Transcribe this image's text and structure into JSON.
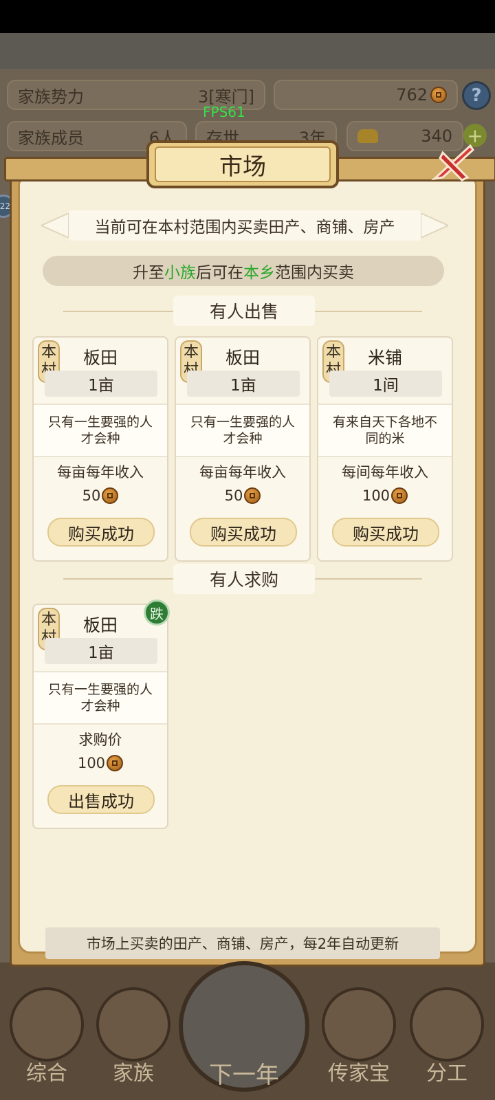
{
  "header": {
    "clan_power_label": "家族势力",
    "clan_power_value": "3[寒门]",
    "coins": "762",
    "members_label": "家族成员",
    "members_value": "6人",
    "alive_label": "存世",
    "alive_value": "3年",
    "gold": "340",
    "help": "?",
    "plus": "+",
    "side_badge": "22"
  },
  "fps": "FPS61",
  "market": {
    "title": "市场",
    "scope_note": "当前可在本村范围内买卖田产、商铺、房产",
    "upgrade_note": {
      "prefix": "升至",
      "rank": "小族",
      "middle": "后可在",
      "area": "本乡",
      "suffix": "范围内买卖"
    },
    "selling_section": "有人出售",
    "selling": [
      {
        "tag": [
          "本",
          "村"
        ],
        "name": "板田",
        "qty": "1亩",
        "desc": "只有一生要强的人才会种",
        "income_label": "每亩每年收入",
        "price": "50",
        "button": "购买成功"
      },
      {
        "tag": [
          "本",
          "村"
        ],
        "name": "板田",
        "qty": "1亩",
        "desc": "只有一生要强的人才会种",
        "income_label": "每亩每年收入",
        "price": "50",
        "button": "购买成功"
      },
      {
        "tag": [
          "本",
          "村"
        ],
        "name": "米铺",
        "qty": "1间",
        "desc": "有来自天下各地不同的米",
        "income_label": "每间每年收入",
        "price": "100",
        "button": "购买成功"
      }
    ],
    "buying_section": "有人求购",
    "buying": [
      {
        "tag": [
          "本",
          "村"
        ],
        "name": "板田",
        "qty": "1亩",
        "badge": "跌",
        "desc": "只有一生要强的人才会种",
        "price_label": "求购价",
        "price": "100",
        "button": "出售成功"
      }
    ],
    "footer_note": "市场上买卖的田产、商铺、房产，每2年自动更新"
  },
  "nav": {
    "items": [
      "综合",
      "家族",
      "下一年",
      "传家宝",
      "分工"
    ]
  },
  "colors": {
    "accent_green": "#2aa62a",
    "panel_bg": "#f6efda",
    "frame": "#caa25d"
  }
}
